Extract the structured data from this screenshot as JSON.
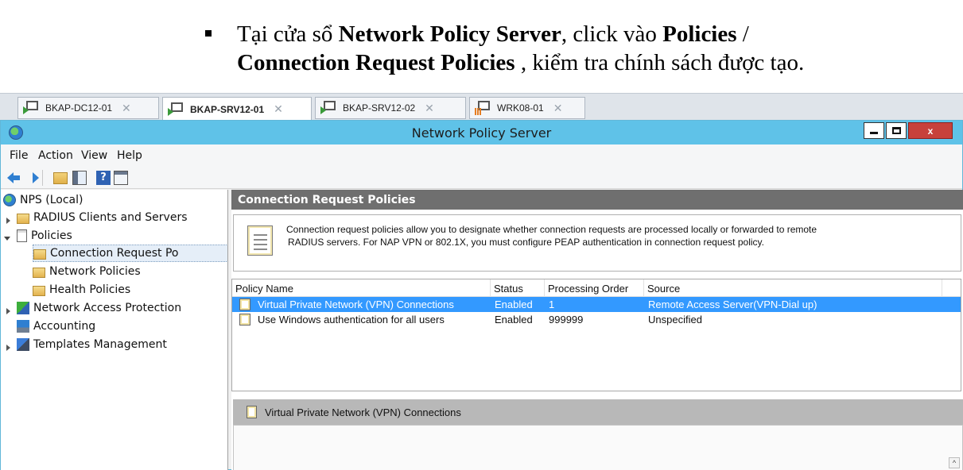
{
  "doc": {
    "line1_pre": "Tại cửa sổ ",
    "line1_bold1": "Network Policy Server",
    "line1_mid": ", click vào ",
    "line1_bold2": "Policies",
    "line1_post": " /",
    "line2_bold": "Connection Request Policies",
    "line2_post": " , kiểm tra chính sách được tạo."
  },
  "vm_tabs": [
    {
      "label": "BKAP-DC12-01",
      "active": false,
      "icon": "vm-connect-icon"
    },
    {
      "label": "BKAP-SRV12-01",
      "active": true,
      "icon": "vm-connect-icon"
    },
    {
      "label": "BKAP-SRV12-02",
      "active": false,
      "icon": "vm-connect-icon"
    },
    {
      "label": "WRK08-01",
      "active": false,
      "icon": "vm-connect-warning-icon"
    }
  ],
  "window": {
    "title": "Network Policy Server",
    "close_label": "x",
    "menu": [
      "File",
      "Action",
      "View",
      "Help"
    ],
    "accent": "#5fc2e8"
  },
  "tree": {
    "root": "NPS (Local)",
    "radius": "RADIUS Clients and Servers",
    "policies": "Policies",
    "conn_req": "Connection Request Po",
    "network_policies": "Network Policies",
    "health_policies": "Health Policies",
    "nap": "Network Access Protection",
    "accounting": "Accounting",
    "templates": "Templates Management"
  },
  "pane": {
    "header": "Connection Request Policies",
    "description_line1": "Connection request policies allow you to designate whether connection requests are processed locally or forwarded to remote",
    "description_line2": "RADIUS servers. For NAP VPN or 802.1X, you must configure PEAP authentication in connection request policy.",
    "columns": [
      "Policy Name",
      "Status",
      "Processing Order",
      "Source"
    ],
    "rows": [
      {
        "name": "Virtual Private Network (VPN) Connections",
        "status": "Enabled",
        "order": "1",
        "source": "Remote Access Server(VPN-Dial up)",
        "selected": true
      },
      {
        "name": "Use Windows authentication for all users",
        "status": "Enabled",
        "order": "999999",
        "source": "Unspecified",
        "selected": false
      }
    ],
    "detail_title": "Virtual Private Network (VPN) Connections"
  }
}
